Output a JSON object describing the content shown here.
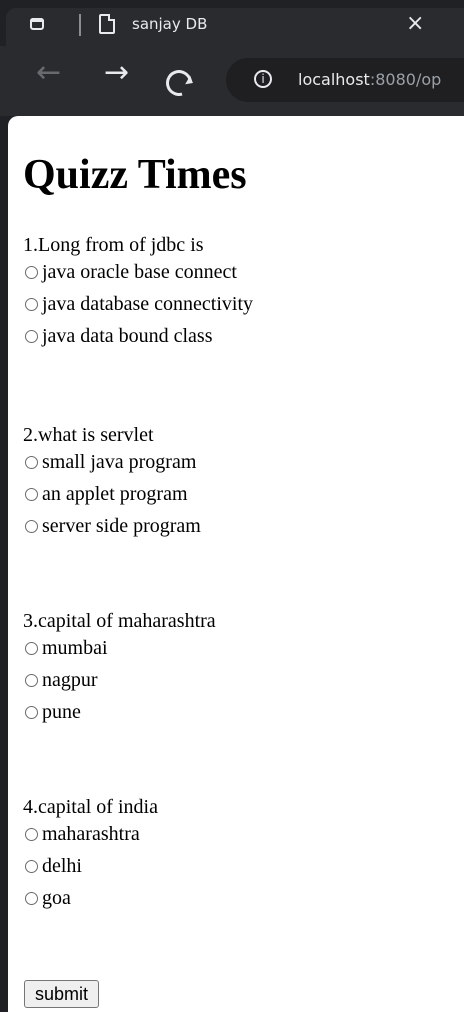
{
  "browser": {
    "tab_title": "sanjay DB",
    "close_symbol": "×",
    "url_host": "localhost",
    "url_rest": ":8080/op",
    "info_symbol": "i"
  },
  "page": {
    "title": "Quizz Times",
    "questions": [
      {
        "text": "1.Long from of jdbc is",
        "options": [
          "java oracle base connect",
          "java database connectivity",
          "java data bound class"
        ]
      },
      {
        "text": "2.what is servlet",
        "options": [
          "small java program",
          "an applet program",
          "server side program"
        ]
      },
      {
        "text": "3.capital of maharashtra",
        "options": [
          "mumbai",
          "nagpur",
          "pune"
        ]
      },
      {
        "text": "4.capital of india",
        "options": [
          "maharashtra",
          "delhi",
          "goa"
        ]
      }
    ],
    "submit_label": "submit"
  }
}
